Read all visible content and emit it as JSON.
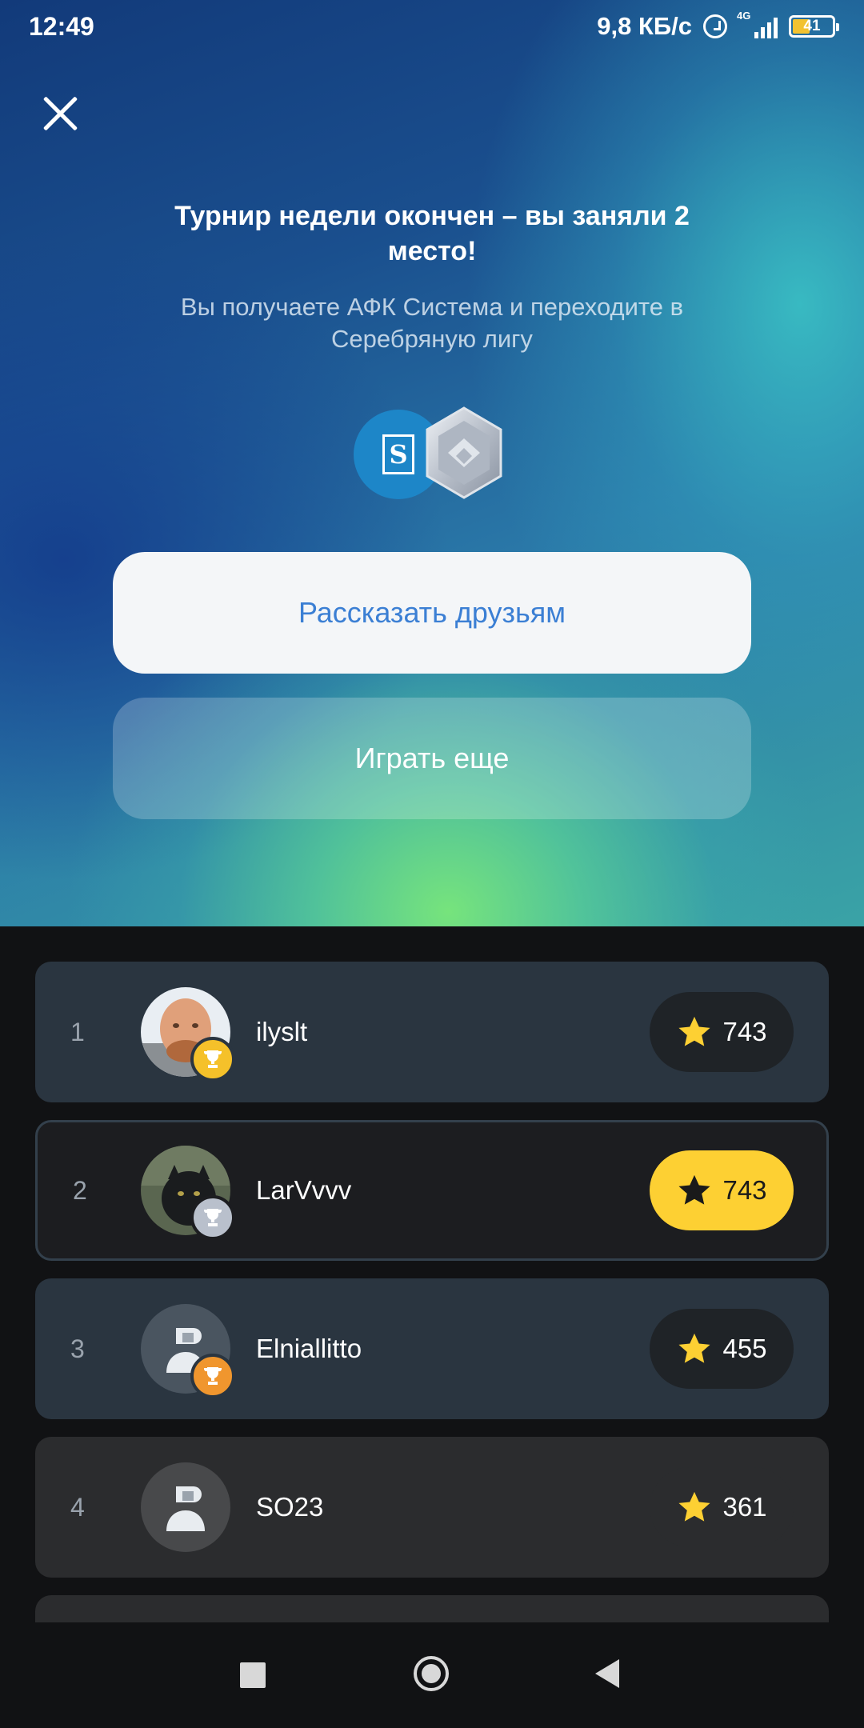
{
  "status_bar": {
    "time": "12:49",
    "net_rate": "9,8 КБ/с",
    "net_type": "4G",
    "battery": "41"
  },
  "hero": {
    "title": "Турнир недели окончен – вы заняли 2 место!",
    "subtitle": "Вы получаете АФК Система и переходите в Серебряную лигу",
    "share_label": "Рассказать друзьям",
    "play_again_label": "Играть еще"
  },
  "leaderboard": {
    "rows": [
      {
        "rank": "1",
        "name": "ilyslt",
        "score": "743",
        "cup": "gold",
        "avatar": "photo-man"
      },
      {
        "rank": "2",
        "name": "LarVvvv",
        "score": "743",
        "cup": "silver",
        "avatar": "photo-cat",
        "current_user": true
      },
      {
        "rank": "3",
        "name": "Elniallitto",
        "score": "455",
        "cup": "bronze",
        "avatar": "default-user"
      },
      {
        "rank": "4",
        "name": "SO23",
        "score": "361",
        "avatar": "default-user"
      }
    ]
  },
  "colors": {
    "accent_blue": "#3b7fd4",
    "score_highlight": "#fdd033",
    "gold": "#f5c12a",
    "silver": "#b9c0cc",
    "bronze": "#f0962e"
  },
  "icons": {
    "close": "close-icon",
    "star": "star-icon",
    "trophy": "trophy-icon",
    "nav_recent": "square-icon",
    "nav_home": "home-circle-icon",
    "nav_back": "back-triangle-icon"
  }
}
